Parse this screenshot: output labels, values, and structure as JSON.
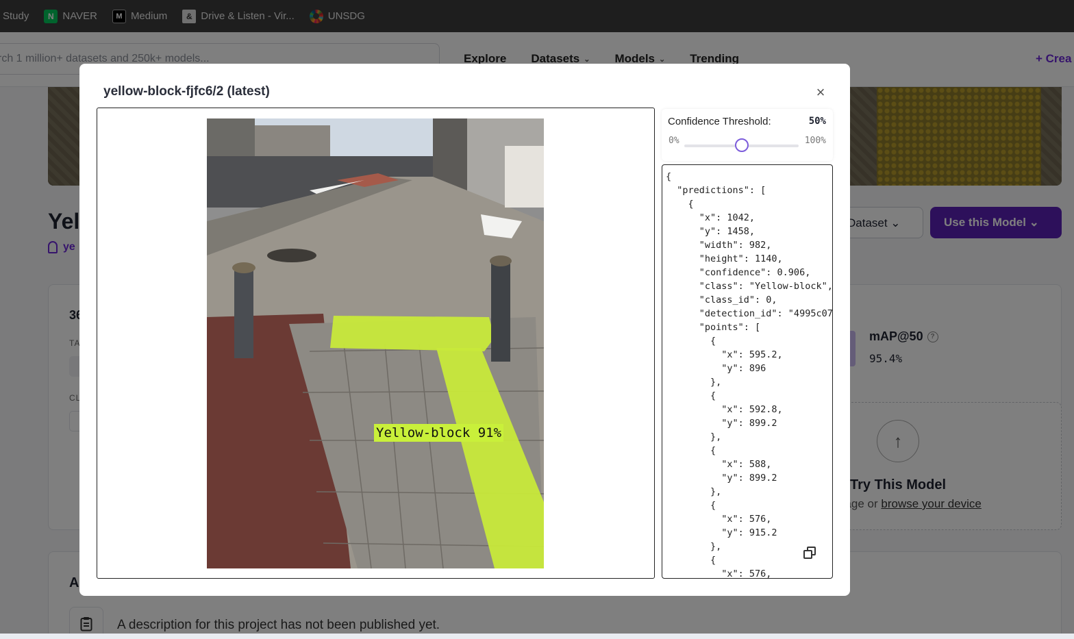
{
  "bookmarks": [
    {
      "label": "Study",
      "icon": "none"
    },
    {
      "label": "NAVER",
      "icon": "naver-icon",
      "glyph": "N"
    },
    {
      "label": "Medium",
      "icon": "medium-icon",
      "glyph": "M"
    },
    {
      "label": "Drive & Listen - Vir...",
      "icon": "drive-listen-icon",
      "glyph": "&"
    },
    {
      "label": "UNSDG",
      "icon": "unsdg-icon",
      "glyph": ""
    }
  ],
  "header": {
    "search_placeholder": "rch 1 million+ datasets and 250k+ models...",
    "nav": [
      "Explore",
      "Datasets",
      "Models",
      "Trending"
    ],
    "nav_chevron": "⌄",
    "create": "+  Crea"
  },
  "page": {
    "title": "Yell",
    "owner": "ye",
    "dataset_button": "Dataset  ⌄",
    "use_model_button": "Use this Model  ⌄",
    "card_number": "36",
    "tags_label": "TA",
    "classes_label": "CL",
    "metric_label": "mAP@50",
    "metric_help": "?",
    "metric_value": "95.4%",
    "try_title": "Try This Model",
    "try_subtitle_prefix": "nage or ",
    "try_subtitle_link": "browse your device",
    "upload_arrow": "↑",
    "about_heading": "A",
    "about_text": "A description for this project has not been published yet."
  },
  "modal": {
    "title": "yellow-block-fjfc6/2 (latest)",
    "close": "×",
    "detection_label": "Yellow-block 91%",
    "confidence_label": "Confidence Threshold:",
    "confidence_value": "50%",
    "confidence_fraction": 0.5,
    "range_min": "0%",
    "range_max": "100%",
    "json_lines": [
      "{",
      "  \"predictions\": [",
      "    {",
      "      \"x\": 1042,",
      "      \"y\": 1458,",
      "      \"width\": 982,",
      "      \"height\": 1140,",
      "      \"confidence\": 0.906,",
      "      \"class\": \"Yellow-block\",",
      "      \"class_id\": 0,",
      "      \"detection_id\": \"4995c07",
      "      \"points\": [",
      "        {",
      "          \"x\": 595.2,",
      "          \"y\": 896",
      "        },",
      "        {",
      "          \"x\": 592.8,",
      "          \"y\": 899.2",
      "        },",
      "        {",
      "          \"x\": 588,",
      "          \"y\": 899.2",
      "        },",
      "        {",
      "          \"x\": 576,",
      "          \"y\": 915.2",
      "        },",
      "        {",
      "          \"x\": 576,"
    ]
  },
  "colors": {
    "accent": "#5b21b6",
    "slider_thumb": "#7c5cdb",
    "detection": "#c9f03a"
  }
}
